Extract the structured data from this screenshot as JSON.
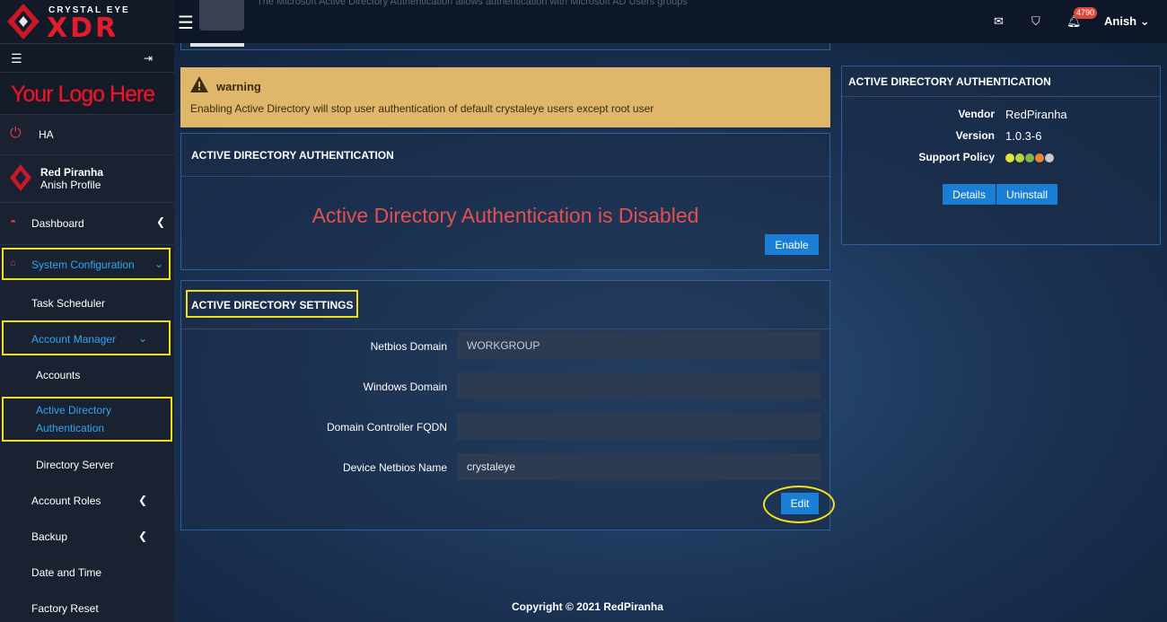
{
  "brand": {
    "small": "CRYSTAL EYE",
    "big": "XDR",
    "logo_placeholder": "Your Logo Here"
  },
  "topbar": {
    "ghost_text": "The Microsoft Active Directory Authentication allows authentication with Microsoft AD Users groups",
    "notification_count": "4790",
    "user": "Anish"
  },
  "sidebar": {
    "ha": "HA",
    "profile_name": "Red Piranha",
    "profile_sub": "Anish Profile",
    "dashboard": "Dashboard",
    "system_configuration": "System Configuration",
    "task_scheduler": "Task Scheduler",
    "account_manager": "Account Manager",
    "accounts": "Accounts",
    "ad_auth_line1": "Active Directory",
    "ad_auth_line2": "Authentication",
    "directory_server": "Directory Server",
    "account_roles": "Account Roles",
    "backup": "Backup",
    "date_time": "Date and Time",
    "factory_reset": "Factory Reset"
  },
  "warning": {
    "title": "warning",
    "message": "Enabling Active Directory will stop user authentication of default crystaleye users except root user"
  },
  "status_panel": {
    "title": "ACTIVE DIRECTORY AUTHENTICATION",
    "message": "Active Directory Authentication is Disabled",
    "enable_label": "Enable"
  },
  "settings_panel": {
    "title": "ACTIVE DIRECTORY SETTINGS",
    "fields": [
      {
        "label": "Netbios Domain",
        "value": "WORKGROUP"
      },
      {
        "label": "Windows Domain",
        "value": ""
      },
      {
        "label": "Domain Controller FQDN",
        "value": ""
      },
      {
        "label": "Device Netbios Name",
        "value": "crystaleye"
      }
    ],
    "edit_label": "Edit"
  },
  "info_panel": {
    "title": "ACTIVE DIRECTORY AUTHENTICATION",
    "vendor_label": "Vendor",
    "vendor_value": "RedPiranha",
    "version_label": "Version",
    "version_value": "1.0.3-6",
    "support_label": "Support Policy",
    "support_colors": [
      "#e8e23a",
      "#b7d443",
      "#79b84a",
      "#e9843a",
      "#c9c9c9"
    ],
    "details_label": "Details",
    "uninstall_label": "Uninstall"
  },
  "footer": {
    "copyright": "Copyright © 2021 RedPiranha"
  },
  "colors": {
    "accent": "#1a7fd4",
    "highlight": "#f1e11b",
    "error": "#e25050",
    "warning_bg": "#dfb66a"
  }
}
